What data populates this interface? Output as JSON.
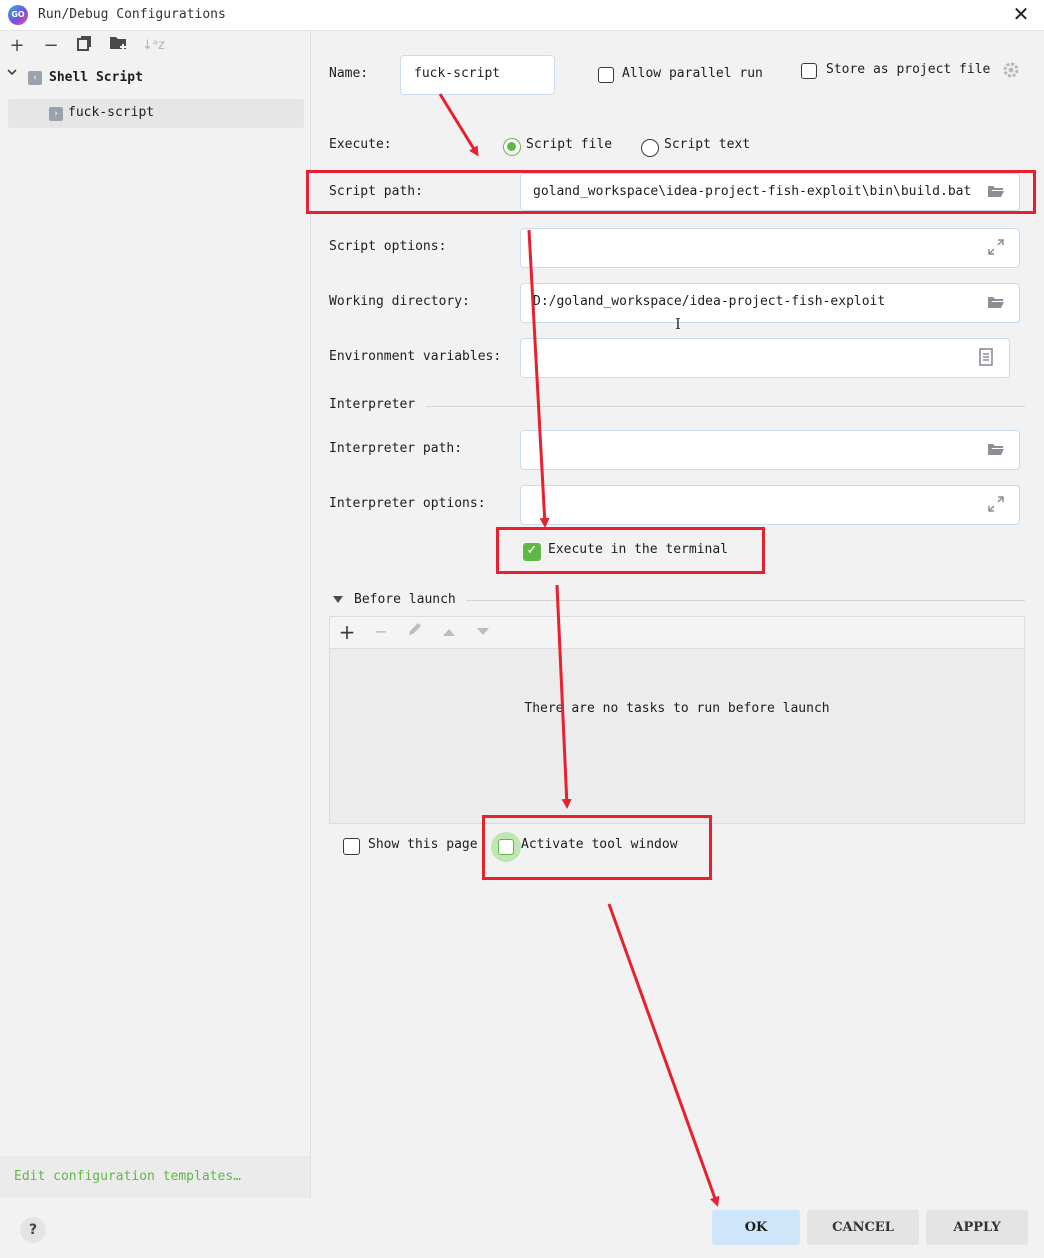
{
  "window": {
    "title": "Run/Debug Configurations",
    "icon": "goland-app-icon",
    "close_icon": "close-icon"
  },
  "left_toolbar": {
    "buttons": [
      "add-icon",
      "remove-icon",
      "copy-icon",
      "folder-add-icon",
      "sort-icon"
    ]
  },
  "tree": {
    "group": {
      "label": "Shell Script",
      "expanded": true
    },
    "items": [
      {
        "label": "fuck-script",
        "selected": true
      }
    ]
  },
  "templates_link": "Edit configuration templates…",
  "form": {
    "name_label": "Name:",
    "name_value": "fuck-script",
    "allow_parallel_label": "Allow parallel run",
    "store_project_label": "Store as project file",
    "execute_label": "Execute:",
    "execute_options": [
      "Script file",
      "Script text"
    ],
    "execute_selected": "Script file",
    "script_path_label": "Script path:",
    "script_path_value": "goland_workspace\\idea-project-fish-exploit\\bin\\build.bat",
    "script_options_label": "Script options:",
    "script_options_value": "",
    "working_dir_label": "Working directory:",
    "working_dir_value": "D:/goland_workspace/idea-project-fish-exploit",
    "env_vars_label": "Environment variables:",
    "env_vars_value": "",
    "interpreter_section": "Interpreter",
    "interpreter_path_label": "Interpreter path:",
    "interpreter_path_value": "",
    "interpreter_options_label": "Interpreter options:",
    "interpreter_options_value": "",
    "execute_in_terminal_label": "Execute in the terminal",
    "execute_in_terminal_checked": true
  },
  "before_launch": {
    "title": "Before launch",
    "empty_text": "There are no tasks to run before launch",
    "toolbar": [
      "add-icon",
      "remove-icon",
      "edit-icon",
      "move-up-icon",
      "move-down-icon"
    ]
  },
  "show_this_page_label": "Show this page",
  "show_this_page_checked": false,
  "activate_tool_window_label": "Activate tool window",
  "activate_tool_window_checked": false,
  "buttons": {
    "ok": "OK",
    "cancel": "CANCEL",
    "apply": "APPLY",
    "help": "?"
  },
  "colors": {
    "accent_green": "#5fb846",
    "annotation_red": "#e8202f",
    "primary_button": "#cfe6fa"
  }
}
